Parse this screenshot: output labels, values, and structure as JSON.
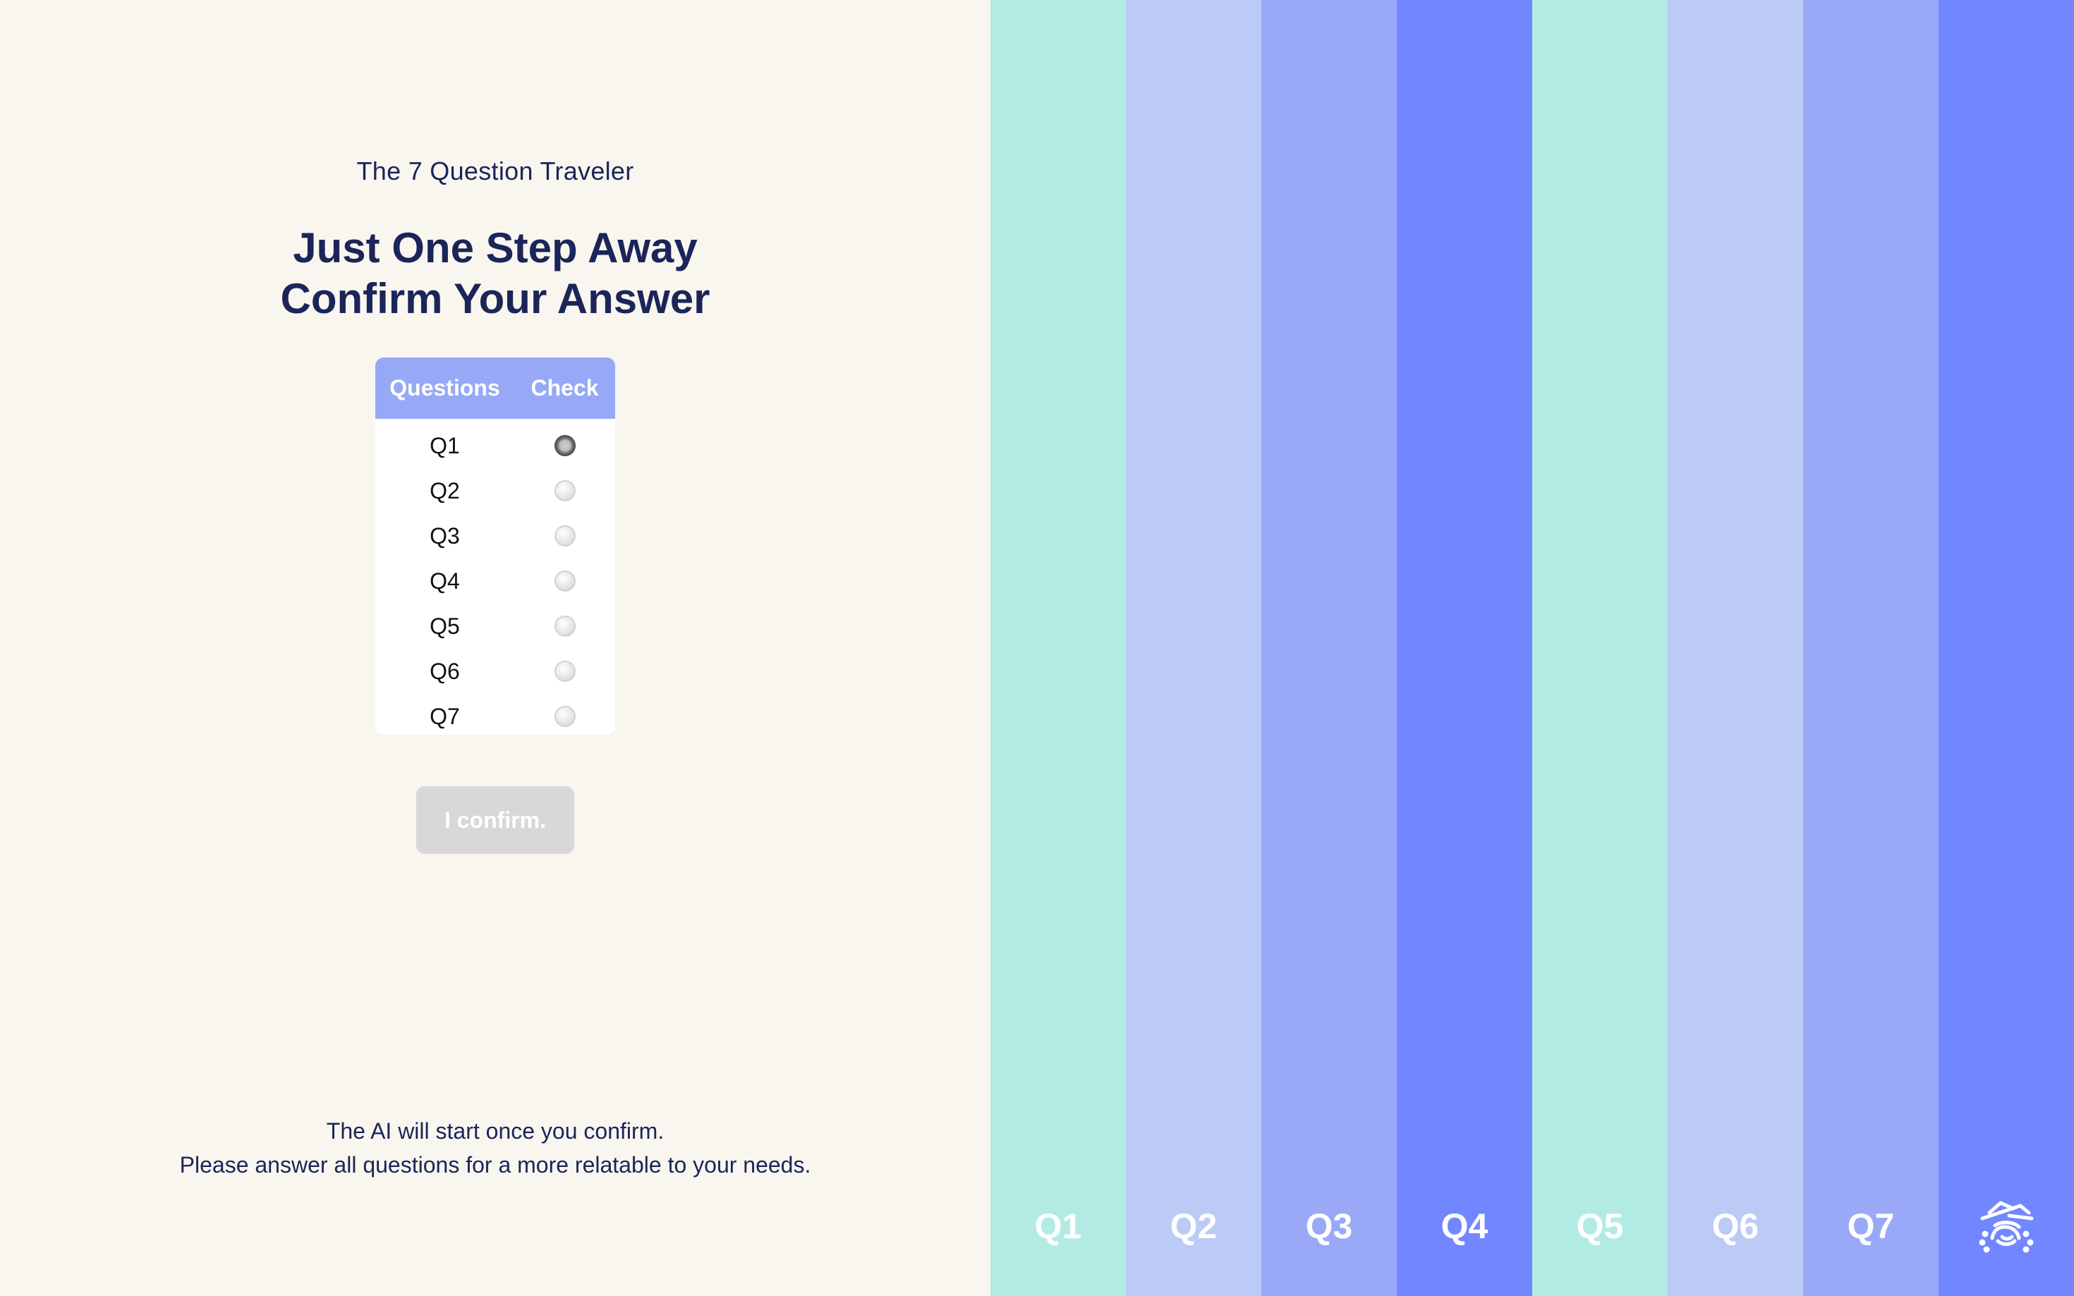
{
  "app_title": "The 7 Question Traveler",
  "headline": {
    "line1": "Just One Step Away",
    "line2": "Confirm Your Answer"
  },
  "table": {
    "header_questions": "Questions",
    "header_check": "Check",
    "rows": [
      {
        "label": "Q1",
        "checked": true
      },
      {
        "label": "Q2",
        "checked": false
      },
      {
        "label": "Q3",
        "checked": false
      },
      {
        "label": "Q4",
        "checked": false
      },
      {
        "label": "Q5",
        "checked": false
      },
      {
        "label": "Q6",
        "checked": false
      },
      {
        "label": "Q7",
        "checked": false
      }
    ]
  },
  "confirm_button": {
    "label": "I confirm.",
    "enabled": false
  },
  "footer": {
    "line1": "The AI will start once you confirm.",
    "line2": "Please answer all questions for a more relatable to your needs."
  },
  "columns": [
    {
      "label": "Q1",
      "color": "#b2ebe3"
    },
    {
      "label": "Q2",
      "color": "#bccaf6"
    },
    {
      "label": "Q3",
      "color": "#99a9f8"
    },
    {
      "label": "Q4",
      "color": "#7287ff"
    },
    {
      "label": "Q5",
      "color": "#b2ebe3"
    },
    {
      "label": "Q6",
      "color": "#bccaf6"
    },
    {
      "label": "Q7",
      "color": "#99a9f8"
    },
    {
      "icon": "traveler-logo-icon",
      "color": "#7287ff"
    }
  ],
  "colors": {
    "background": "#f9f6ef",
    "text_primary": "#1b2559",
    "table_header": "#97a8f6",
    "button_disabled": "#d8d8d8"
  }
}
